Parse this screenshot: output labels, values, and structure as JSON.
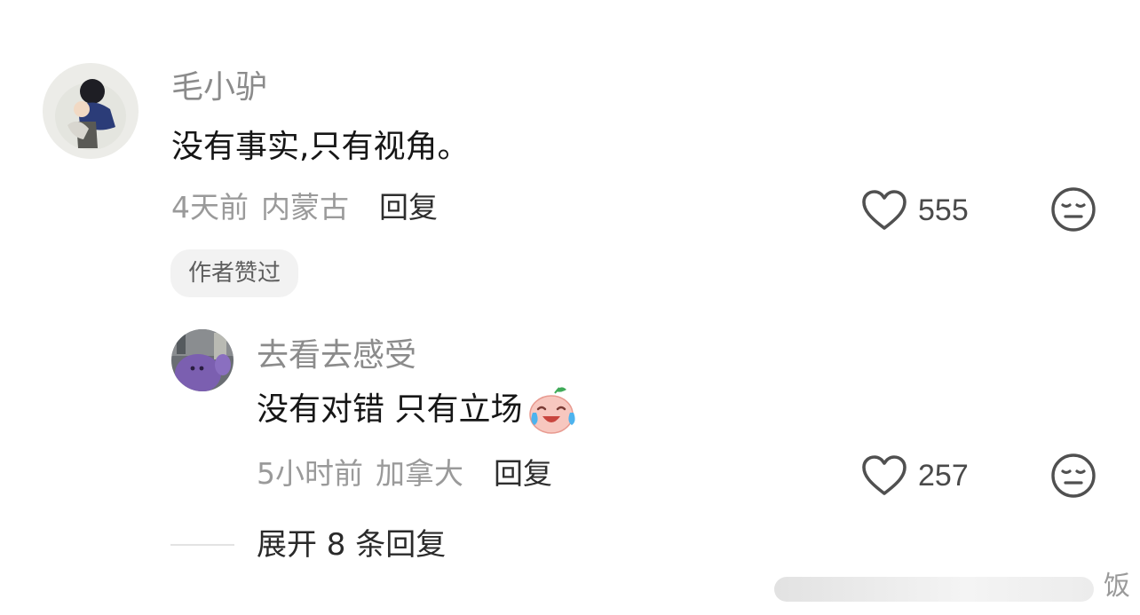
{
  "comments": [
    {
      "username": "毛小驴",
      "content": "没有事实,只有视角。",
      "time": "4天前",
      "location": "内蒙古",
      "reply_label": "回复",
      "likes": "555",
      "badge": "作者赞过"
    }
  ],
  "replies": [
    {
      "username": "去看去感受",
      "content": "没有对错 只有立场",
      "time": "5小时前",
      "location": "加拿大",
      "reply_label": "回复",
      "likes": "257"
    }
  ],
  "expand_label": "展开 8 条回复",
  "watermark": "饭",
  "icons": {
    "like": "heart-outline-icon",
    "reaction": "neutral-face-icon",
    "emoji": "laughing-crying-face-emoji"
  },
  "colors": {
    "username": "#8b8b8b",
    "content": "#161616",
    "meta": "#9a9a9a",
    "badge_bg": "#f2f2f2"
  }
}
